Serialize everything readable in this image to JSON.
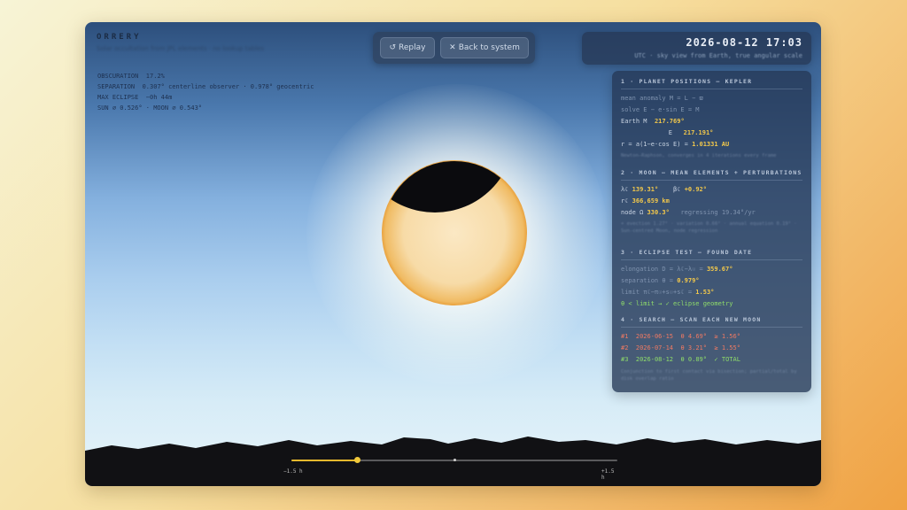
{
  "app": {
    "title": "ORRERY",
    "subtitle": "Solar occultation from JPL elements · no lookup tables"
  },
  "stats": [
    {
      "label": "OBSCURATION",
      "value": "17.2%"
    },
    {
      "label": "SEPARATION",
      "value": "0.307° centerline observer  ·  0.978° geocentric"
    },
    {
      "label": "MAX ECLIPSE",
      "value": "−0h 44m"
    },
    {
      "label": "SUN ⌀ 0.526°  ·  MOON ⌀ 0.543°",
      "value": ""
    }
  ],
  "controls": {
    "replay_icon": "↺",
    "replay_label": "Replay",
    "back_icon": "✕",
    "back_label": "Back to system"
  },
  "datetime": {
    "value": "2026-08-12 17:03",
    "caption": "UTC · sky view from Earth, true angular scale"
  },
  "panel": {
    "s1": {
      "title": "1 · PLANET POSITIONS — KEPLER",
      "l1": "mean anomaly  M = L − ϖ",
      "l2": "solve  E − e·sin E = M",
      "earth_label": "Earth   M",
      "earth_m": "217.769°",
      "e_label": "E",
      "earth_e": "217.191°",
      "r_label": "r = a(1−e·cos E) = ",
      "r_value": "1.01331 AU",
      "note": "Newton–Raphson, converges in 4 iterations every frame"
    },
    "s2": {
      "title": "2 · MOON — MEAN ELEMENTS + PERTURBATIONS",
      "lambda_label": "λ☾",
      "lambda_value": "139.31°",
      "beta_label": "β☾",
      "beta_value": "+0.92°",
      "r_label": "r☾",
      "r_value": "366,659 km",
      "node_label": "node Ω",
      "node_value": "330.3°",
      "node_note": "regressing 19.34°/yr",
      "note": "+ evection 1.27° · variation 0.66° · annual equation 0.19° · Sun-centred Moon, node regression"
    },
    "s3": {
      "title": "3 · ECLIPSE TEST — FOUND DATE",
      "elong_label": "elongation  D = λ☾−λ☉ = ",
      "elong_value": "359.67°",
      "sep_label": "separation  θ = ",
      "sep_value": "0.979°",
      "limit_label": "limit  π☾−π☉+s☉+s☾ = ",
      "limit_value": "1.53°",
      "result": "θ < limit  →  ✓ eclipse geometry"
    },
    "s4": {
      "title": "4 · SEARCH — SCAN EACH NEW MOON",
      "rows": [
        {
          "idx": "#1",
          "date": "2026-06-15",
          "theta": "θ 4.69°",
          "limit": "≥ 1.56°",
          "status": "fail"
        },
        {
          "idx": "#2",
          "date": "2026-07-14",
          "theta": "θ 3.21°",
          "limit": "≥ 1.55°",
          "status": "fail"
        },
        {
          "idx": "#3",
          "date": "2026-08-12",
          "theta": "θ 0.89°",
          "limit": "✓ TOTAL",
          "status": "ok"
        }
      ],
      "note": "Conjunction to first contact via bisection; partial/total by disk overlap ratio"
    }
  },
  "scrubber": {
    "start_label": "−1.5 h",
    "end_label": "+1.5 h",
    "progress": 0.2
  },
  "colors": {
    "accent": "#f2c84b",
    "ok": "#8fdc6a",
    "fail": "#ef7a63",
    "sun": "#f5d9a0",
    "moon": "#0b0b0e"
  }
}
